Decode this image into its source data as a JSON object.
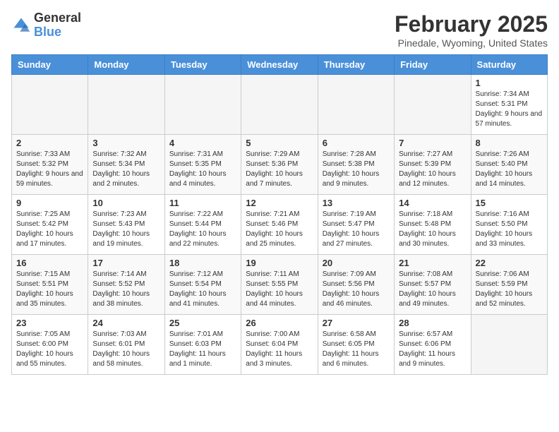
{
  "header": {
    "logo_general": "General",
    "logo_blue": "Blue",
    "month_title": "February 2025",
    "location": "Pinedale, Wyoming, United States"
  },
  "days_of_week": [
    "Sunday",
    "Monday",
    "Tuesday",
    "Wednesday",
    "Thursday",
    "Friday",
    "Saturday"
  ],
  "weeks": [
    [
      {
        "day": "",
        "info": ""
      },
      {
        "day": "",
        "info": ""
      },
      {
        "day": "",
        "info": ""
      },
      {
        "day": "",
        "info": ""
      },
      {
        "day": "",
        "info": ""
      },
      {
        "day": "",
        "info": ""
      },
      {
        "day": "1",
        "info": "Sunrise: 7:34 AM\nSunset: 5:31 PM\nDaylight: 9 hours and 57 minutes."
      }
    ],
    [
      {
        "day": "2",
        "info": "Sunrise: 7:33 AM\nSunset: 5:32 PM\nDaylight: 9 hours and 59 minutes."
      },
      {
        "day": "3",
        "info": "Sunrise: 7:32 AM\nSunset: 5:34 PM\nDaylight: 10 hours and 2 minutes."
      },
      {
        "day": "4",
        "info": "Sunrise: 7:31 AM\nSunset: 5:35 PM\nDaylight: 10 hours and 4 minutes."
      },
      {
        "day": "5",
        "info": "Sunrise: 7:29 AM\nSunset: 5:36 PM\nDaylight: 10 hours and 7 minutes."
      },
      {
        "day": "6",
        "info": "Sunrise: 7:28 AM\nSunset: 5:38 PM\nDaylight: 10 hours and 9 minutes."
      },
      {
        "day": "7",
        "info": "Sunrise: 7:27 AM\nSunset: 5:39 PM\nDaylight: 10 hours and 12 minutes."
      },
      {
        "day": "8",
        "info": "Sunrise: 7:26 AM\nSunset: 5:40 PM\nDaylight: 10 hours and 14 minutes."
      }
    ],
    [
      {
        "day": "9",
        "info": "Sunrise: 7:25 AM\nSunset: 5:42 PM\nDaylight: 10 hours and 17 minutes."
      },
      {
        "day": "10",
        "info": "Sunrise: 7:23 AM\nSunset: 5:43 PM\nDaylight: 10 hours and 19 minutes."
      },
      {
        "day": "11",
        "info": "Sunrise: 7:22 AM\nSunset: 5:44 PM\nDaylight: 10 hours and 22 minutes."
      },
      {
        "day": "12",
        "info": "Sunrise: 7:21 AM\nSunset: 5:46 PM\nDaylight: 10 hours and 25 minutes."
      },
      {
        "day": "13",
        "info": "Sunrise: 7:19 AM\nSunset: 5:47 PM\nDaylight: 10 hours and 27 minutes."
      },
      {
        "day": "14",
        "info": "Sunrise: 7:18 AM\nSunset: 5:48 PM\nDaylight: 10 hours and 30 minutes."
      },
      {
        "day": "15",
        "info": "Sunrise: 7:16 AM\nSunset: 5:50 PM\nDaylight: 10 hours and 33 minutes."
      }
    ],
    [
      {
        "day": "16",
        "info": "Sunrise: 7:15 AM\nSunset: 5:51 PM\nDaylight: 10 hours and 35 minutes."
      },
      {
        "day": "17",
        "info": "Sunrise: 7:14 AM\nSunset: 5:52 PM\nDaylight: 10 hours and 38 minutes."
      },
      {
        "day": "18",
        "info": "Sunrise: 7:12 AM\nSunset: 5:54 PM\nDaylight: 10 hours and 41 minutes."
      },
      {
        "day": "19",
        "info": "Sunrise: 7:11 AM\nSunset: 5:55 PM\nDaylight: 10 hours and 44 minutes."
      },
      {
        "day": "20",
        "info": "Sunrise: 7:09 AM\nSunset: 5:56 PM\nDaylight: 10 hours and 46 minutes."
      },
      {
        "day": "21",
        "info": "Sunrise: 7:08 AM\nSunset: 5:57 PM\nDaylight: 10 hours and 49 minutes."
      },
      {
        "day": "22",
        "info": "Sunrise: 7:06 AM\nSunset: 5:59 PM\nDaylight: 10 hours and 52 minutes."
      }
    ],
    [
      {
        "day": "23",
        "info": "Sunrise: 7:05 AM\nSunset: 6:00 PM\nDaylight: 10 hours and 55 minutes."
      },
      {
        "day": "24",
        "info": "Sunrise: 7:03 AM\nSunset: 6:01 PM\nDaylight: 10 hours and 58 minutes."
      },
      {
        "day": "25",
        "info": "Sunrise: 7:01 AM\nSunset: 6:03 PM\nDaylight: 11 hours and 1 minute."
      },
      {
        "day": "26",
        "info": "Sunrise: 7:00 AM\nSunset: 6:04 PM\nDaylight: 11 hours and 3 minutes."
      },
      {
        "day": "27",
        "info": "Sunrise: 6:58 AM\nSunset: 6:05 PM\nDaylight: 11 hours and 6 minutes."
      },
      {
        "day": "28",
        "info": "Sunrise: 6:57 AM\nSunset: 6:06 PM\nDaylight: 11 hours and 9 minutes."
      },
      {
        "day": "",
        "info": ""
      }
    ]
  ]
}
